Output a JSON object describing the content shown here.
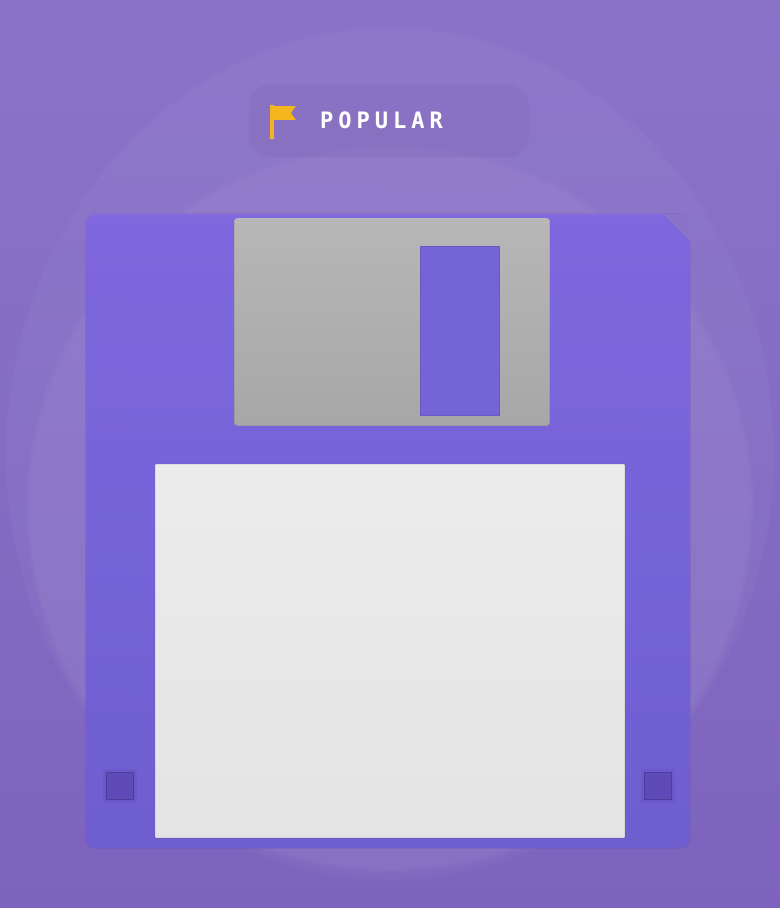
{
  "brand": {
    "text": "POPULAR",
    "icon": "flag-icon",
    "icon_color": "#f5b51d"
  },
  "disk": {
    "icon": "floppy-disk-icon",
    "body_color": "#7563d8",
    "shutter_color": "#adadad",
    "label_color": "#e8e8e8",
    "background_color": "#8a6fc8"
  }
}
